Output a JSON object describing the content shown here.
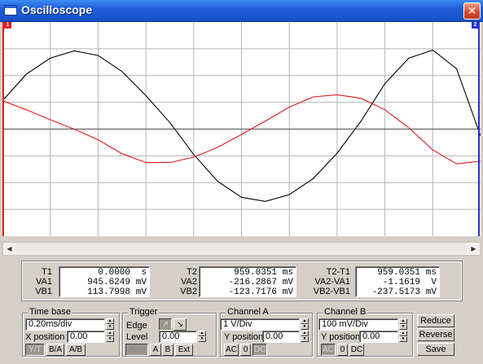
{
  "window": {
    "title": "Oscilloscope",
    "close_glyph": "✕"
  },
  "cursors": {
    "t1_label": "1",
    "t2_label": "2",
    "t1_color": "#e02020",
    "t2_color": "#2030d0"
  },
  "chart_data": {
    "type": "line",
    "xlim": [
      0,
      10
    ],
    "ylim": [
      -4,
      4
    ],
    "grid": true,
    "series": [
      {
        "color": "#000000",
        "points": [
          [
            0,
            1.06
          ],
          [
            0.5,
            2.05
          ],
          [
            1,
            2.65
          ],
          [
            1.5,
            2.92
          ],
          [
            2,
            2.75
          ],
          [
            2.5,
            2.15
          ],
          [
            3,
            1.25
          ],
          [
            3.5,
            0.25
          ],
          [
            4,
            -0.95
          ],
          [
            4.5,
            -1.95
          ],
          [
            5,
            -2.55
          ],
          [
            5.5,
            -2.7
          ],
          [
            6,
            -2.45
          ],
          [
            6.5,
            -1.85
          ],
          [
            7,
            -0.9
          ],
          [
            7.5,
            0.3
          ],
          [
            8,
            1.7
          ],
          [
            8.5,
            2.65
          ],
          [
            9,
            2.95
          ],
          [
            9.5,
            2.25
          ],
          [
            10,
            -0.25
          ]
        ]
      },
      {
        "color": "#e01818",
        "points": [
          [
            0,
            1.06
          ],
          [
            0.5,
            0.72
          ],
          [
            1,
            0.35
          ],
          [
            1.5,
            0.0
          ],
          [
            2,
            -0.4
          ],
          [
            2.5,
            -0.92
          ],
          [
            3,
            -1.25
          ],
          [
            3.5,
            -1.25
          ],
          [
            4,
            -1.05
          ],
          [
            4.5,
            -0.68
          ],
          [
            5,
            -0.2
          ],
          [
            5.5,
            0.3
          ],
          [
            6,
            0.82
          ],
          [
            6.5,
            1.2
          ],
          [
            7,
            1.28
          ],
          [
            7.5,
            1.15
          ],
          [
            8,
            0.72
          ],
          [
            8.5,
            0.05
          ],
          [
            9,
            -0.78
          ],
          [
            9.5,
            -1.3
          ],
          [
            10,
            -1.2
          ]
        ]
      }
    ]
  },
  "measurements": {
    "labels": [
      "T1",
      "VA1",
      "VB1"
    ],
    "values": [
      "0.0000",
      "945.6249",
      "113.7998"
    ],
    "units": [
      "s",
      "mV",
      "mV"
    ],
    "t2_labels": [
      "T2",
      "VA2",
      "VB2"
    ],
    "t2_values": [
      "959.0351",
      "-216.2867",
      "-123.7176"
    ],
    "t2_units": [
      "ms",
      "mV",
      "mV"
    ],
    "delta_labels": [
      "T2-T1",
      "VA2-VA1",
      "VB2-VB1"
    ],
    "delta_values": [
      "959.0351",
      "-1.1619",
      "-237.5173"
    ],
    "delta_units": [
      "ms",
      "V",
      "mV"
    ]
  },
  "timebase": {
    "title": "Time base",
    "scale": "0.20ms/div",
    "xpos_label": "X position",
    "xpos_value": "0.00",
    "modes": [
      "Y/T",
      "B/A",
      "A/B"
    ]
  },
  "trigger": {
    "title": "Trigger",
    "edge_label": "Edge",
    "edge_rise": "↗",
    "edge_fall": "↘",
    "level_label": "Level",
    "level_value": "0.00",
    "sources": [
      "Auto",
      "A",
      "B",
      "Ext"
    ]
  },
  "channel_a": {
    "title": "Channel A",
    "scale": "1 V/Div",
    "ypos_label": "Y position",
    "ypos_value": "0.00",
    "coupling": [
      "AC",
      "0",
      "DC"
    ]
  },
  "channel_b": {
    "title": "Channel B",
    "scale": "100 mV/Div",
    "ypos_label": "Y position",
    "ypos_value": "0.00",
    "coupling": [
      "AC",
      "0",
      "DC"
    ]
  },
  "actions": {
    "reduce": "Reduce",
    "reverse": "Reverse",
    "save": "Save"
  },
  "scrollbar": {
    "left_glyph": "◀",
    "right_glyph": "▶"
  }
}
